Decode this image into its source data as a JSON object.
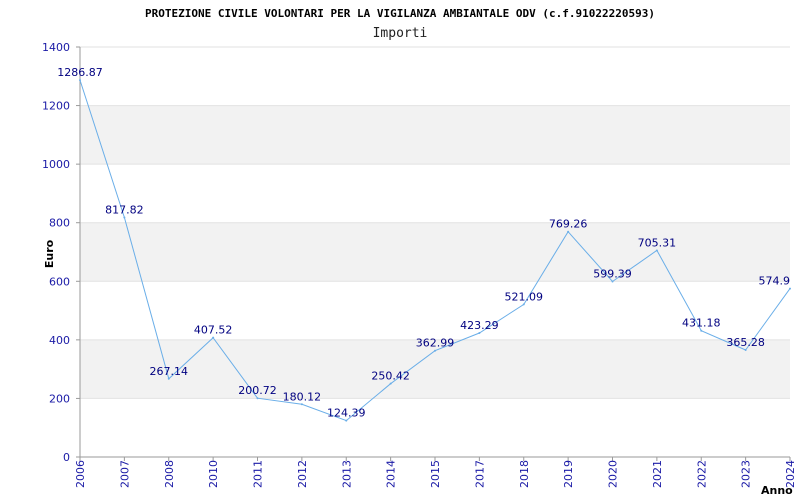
{
  "chart_data": {
    "type": "line",
    "title": "PROTEZIONE CIVILE VOLONTARI PER LA VIGILANZA AMBIANTALE ODV (c.f.91022220593)",
    "subtitle": "Importi",
    "xlabel": "Anno",
    "ylabel": "Euro",
    "ylim": [
      0,
      1400
    ],
    "yticks": [
      0,
      200,
      400,
      600,
      800,
      1000,
      1200,
      1400
    ],
    "grid": "alternating horizontal bands",
    "categories": [
      "2006",
      "2007",
      "2008",
      "2010",
      "2011",
      "2012",
      "2013",
      "2014",
      "2015",
      "2017",
      "2018",
      "2019",
      "2020",
      "2021",
      "2022",
      "2023",
      "2024"
    ],
    "values": [
      1286.87,
      817.82,
      267.14,
      407.52,
      200.72,
      180.12,
      124.39,
      250.42,
      362.99,
      423.29,
      521.09,
      769.26,
      599.39,
      705.31,
      431.18,
      365.28,
      574.9
    ],
    "data_labels": [
      "1286.87",
      "817.82",
      "267.14",
      "407.52",
      "200.72",
      "180.12",
      "124.39",
      "250.42",
      "362.99",
      "423.29",
      "521.09",
      "769.26",
      "599.39",
      "705.31",
      "431.18",
      "365.28",
      "574.9"
    ],
    "colors": {
      "line": "#6aaee8",
      "band": "#f2f2f2",
      "tick_text": "#1a1aa6",
      "data_label": "#000080"
    }
  }
}
